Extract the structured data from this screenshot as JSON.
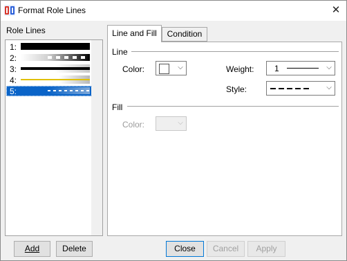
{
  "window": {
    "title": "Format Role Lines",
    "close_glyph": "✕"
  },
  "role_lines": {
    "heading": "Role Lines",
    "items": [
      {
        "label": "1:",
        "style": "thick-black"
      },
      {
        "label": "2:",
        "style": "white-dashed"
      },
      {
        "label": "3:",
        "style": "black-gradient"
      },
      {
        "label": "4:",
        "style": "yellow-thin"
      },
      {
        "label": "5:",
        "style": "white-dashed-selected",
        "selected": true
      }
    ]
  },
  "tabs": [
    {
      "label": "Line and Fill",
      "active": true
    },
    {
      "label": "Condition",
      "active": false
    }
  ],
  "line_group": {
    "title": "Line",
    "color_label": "Color:",
    "color_value": "#ffffff",
    "weight_label": "Weight:",
    "weight_value": "1",
    "style_label": "Style:",
    "style_value": "dashed"
  },
  "fill_group": {
    "title": "Fill",
    "color_label": "Color:"
  },
  "buttons": {
    "add": "Add",
    "delete": "Delete",
    "close": "Close",
    "cancel": "Cancel",
    "apply": "Apply"
  },
  "colors": {
    "selection": "#0a64c8",
    "dialog_bg": "#f0f0f0"
  },
  "icons": {
    "app": "app-logo-icon",
    "dropdown": "chevron-down-icon",
    "close": "close-icon"
  }
}
